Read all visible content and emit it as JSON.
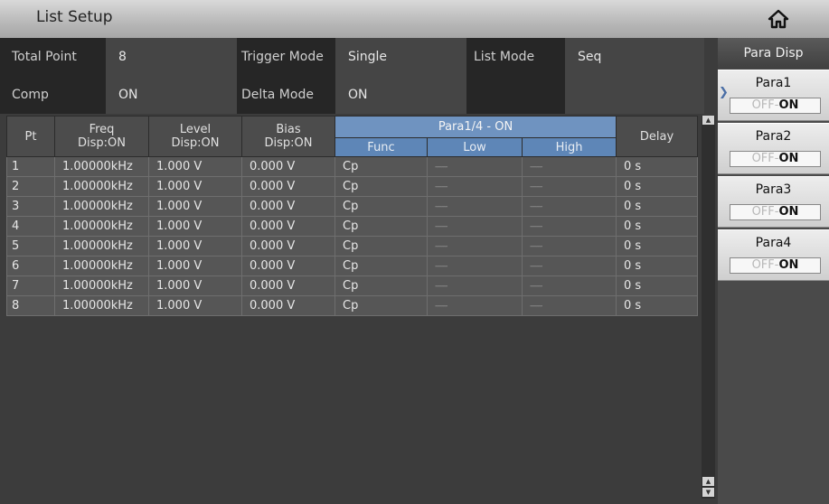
{
  "title": "List Setup",
  "settings": {
    "total_point_label": "Total Point",
    "total_point_value": "8",
    "trigger_mode_label": "Trigger Mode",
    "trigger_mode_value": "Single",
    "list_mode_label": "List Mode",
    "list_mode_value": "Seq",
    "comp_label": "Comp",
    "comp_value": "ON",
    "delta_mode_label": "Delta Mode",
    "delta_mode_value": "ON"
  },
  "table": {
    "headers": {
      "pt": "Pt",
      "freq": "Freq",
      "freq_sub": "Disp:ON",
      "level": "Level",
      "level_sub": "Disp:ON",
      "bias": "Bias",
      "bias_sub": "Disp:ON",
      "para": "Para1/4 - ON",
      "func": "Func",
      "low": "Low",
      "high": "High",
      "delay": "Delay"
    },
    "rows": [
      [
        "1",
        "1.00000kHz",
        "1.000 V",
        "0.000 V",
        "Cp",
        "------",
        "------",
        "0 s"
      ],
      [
        "2",
        "1.00000kHz",
        "1.000 V",
        "0.000 V",
        "Cp",
        "------",
        "------",
        "0 s"
      ],
      [
        "3",
        "1.00000kHz",
        "1.000 V",
        "0.000 V",
        "Cp",
        "------",
        "------",
        "0 s"
      ],
      [
        "4",
        "1.00000kHz",
        "1.000 V",
        "0.000 V",
        "Cp",
        "------",
        "------",
        "0 s"
      ],
      [
        "5",
        "1.00000kHz",
        "1.000 V",
        "0.000 V",
        "Cp",
        "------",
        "------",
        "0 s"
      ],
      [
        "6",
        "1.00000kHz",
        "1.000 V",
        "0.000 V",
        "Cp",
        "------",
        "------",
        "0 s"
      ],
      [
        "7",
        "1.00000kHz",
        "1.000 V",
        "0.000 V",
        "Cp",
        "------",
        "------",
        "0 s"
      ],
      [
        "8",
        "1.00000kHz",
        "1.000 V",
        "0.000 V",
        "Cp",
        "------",
        "------",
        "0 s"
      ]
    ]
  },
  "sidemenu": {
    "title": "Para Disp",
    "buttons": [
      {
        "label": "Para1",
        "off": "OFF",
        "sep": "-",
        "on": "ON"
      },
      {
        "label": "Para2",
        "off": "OFF",
        "sep": "-",
        "on": "ON"
      },
      {
        "label": "Para3",
        "off": "OFF",
        "sep": "-",
        "on": "ON"
      },
      {
        "label": "Para4",
        "off": "OFF",
        "sep": "-",
        "on": "ON"
      }
    ]
  },
  "icons": {
    "home": "home-icon",
    "scroll_up": "scroll-up-icon",
    "scroll_down": "scroll-down-icon",
    "selected_marker": "chevron-right-icon"
  },
  "colors": {
    "para_header": "#6f93c0",
    "title_bar": "#c4c4c4",
    "background": "#3c3c3c"
  }
}
